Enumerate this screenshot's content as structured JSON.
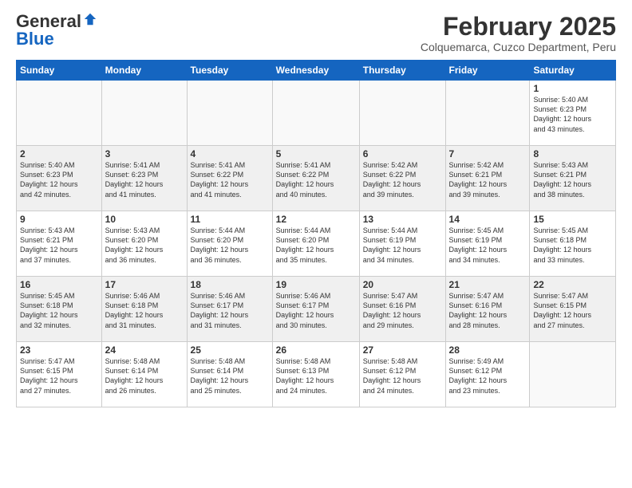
{
  "logo": {
    "general": "General",
    "blue": "Blue"
  },
  "title": "February 2025",
  "subtitle": "Colquemarca, Cuzco Department, Peru",
  "headers": [
    "Sunday",
    "Monday",
    "Tuesday",
    "Wednesday",
    "Thursday",
    "Friday",
    "Saturday"
  ],
  "weeks": [
    [
      {
        "day": "",
        "info": ""
      },
      {
        "day": "",
        "info": ""
      },
      {
        "day": "",
        "info": ""
      },
      {
        "day": "",
        "info": ""
      },
      {
        "day": "",
        "info": ""
      },
      {
        "day": "",
        "info": ""
      },
      {
        "day": "1",
        "info": "Sunrise: 5:40 AM\nSunset: 6:23 PM\nDaylight: 12 hours\nand 43 minutes."
      }
    ],
    [
      {
        "day": "2",
        "info": "Sunrise: 5:40 AM\nSunset: 6:23 PM\nDaylight: 12 hours\nand 42 minutes."
      },
      {
        "day": "3",
        "info": "Sunrise: 5:41 AM\nSunset: 6:23 PM\nDaylight: 12 hours\nand 41 minutes."
      },
      {
        "day": "4",
        "info": "Sunrise: 5:41 AM\nSunset: 6:22 PM\nDaylight: 12 hours\nand 41 minutes."
      },
      {
        "day": "5",
        "info": "Sunrise: 5:41 AM\nSunset: 6:22 PM\nDaylight: 12 hours\nand 40 minutes."
      },
      {
        "day": "6",
        "info": "Sunrise: 5:42 AM\nSunset: 6:22 PM\nDaylight: 12 hours\nand 39 minutes."
      },
      {
        "day": "7",
        "info": "Sunrise: 5:42 AM\nSunset: 6:21 PM\nDaylight: 12 hours\nand 39 minutes."
      },
      {
        "day": "8",
        "info": "Sunrise: 5:43 AM\nSunset: 6:21 PM\nDaylight: 12 hours\nand 38 minutes."
      }
    ],
    [
      {
        "day": "9",
        "info": "Sunrise: 5:43 AM\nSunset: 6:21 PM\nDaylight: 12 hours\nand 37 minutes."
      },
      {
        "day": "10",
        "info": "Sunrise: 5:43 AM\nSunset: 6:20 PM\nDaylight: 12 hours\nand 36 minutes."
      },
      {
        "day": "11",
        "info": "Sunrise: 5:44 AM\nSunset: 6:20 PM\nDaylight: 12 hours\nand 36 minutes."
      },
      {
        "day": "12",
        "info": "Sunrise: 5:44 AM\nSunset: 6:20 PM\nDaylight: 12 hours\nand 35 minutes."
      },
      {
        "day": "13",
        "info": "Sunrise: 5:44 AM\nSunset: 6:19 PM\nDaylight: 12 hours\nand 34 minutes."
      },
      {
        "day": "14",
        "info": "Sunrise: 5:45 AM\nSunset: 6:19 PM\nDaylight: 12 hours\nand 34 minutes."
      },
      {
        "day": "15",
        "info": "Sunrise: 5:45 AM\nSunset: 6:18 PM\nDaylight: 12 hours\nand 33 minutes."
      }
    ],
    [
      {
        "day": "16",
        "info": "Sunrise: 5:45 AM\nSunset: 6:18 PM\nDaylight: 12 hours\nand 32 minutes."
      },
      {
        "day": "17",
        "info": "Sunrise: 5:46 AM\nSunset: 6:18 PM\nDaylight: 12 hours\nand 31 minutes."
      },
      {
        "day": "18",
        "info": "Sunrise: 5:46 AM\nSunset: 6:17 PM\nDaylight: 12 hours\nand 31 minutes."
      },
      {
        "day": "19",
        "info": "Sunrise: 5:46 AM\nSunset: 6:17 PM\nDaylight: 12 hours\nand 30 minutes."
      },
      {
        "day": "20",
        "info": "Sunrise: 5:47 AM\nSunset: 6:16 PM\nDaylight: 12 hours\nand 29 minutes."
      },
      {
        "day": "21",
        "info": "Sunrise: 5:47 AM\nSunset: 6:16 PM\nDaylight: 12 hours\nand 28 minutes."
      },
      {
        "day": "22",
        "info": "Sunrise: 5:47 AM\nSunset: 6:15 PM\nDaylight: 12 hours\nand 27 minutes."
      }
    ],
    [
      {
        "day": "23",
        "info": "Sunrise: 5:47 AM\nSunset: 6:15 PM\nDaylight: 12 hours\nand 27 minutes."
      },
      {
        "day": "24",
        "info": "Sunrise: 5:48 AM\nSunset: 6:14 PM\nDaylight: 12 hours\nand 26 minutes."
      },
      {
        "day": "25",
        "info": "Sunrise: 5:48 AM\nSunset: 6:14 PM\nDaylight: 12 hours\nand 25 minutes."
      },
      {
        "day": "26",
        "info": "Sunrise: 5:48 AM\nSunset: 6:13 PM\nDaylight: 12 hours\nand 24 minutes."
      },
      {
        "day": "27",
        "info": "Sunrise: 5:48 AM\nSunset: 6:12 PM\nDaylight: 12 hours\nand 24 minutes."
      },
      {
        "day": "28",
        "info": "Sunrise: 5:49 AM\nSunset: 6:12 PM\nDaylight: 12 hours\nand 23 minutes."
      },
      {
        "day": "",
        "info": ""
      }
    ]
  ]
}
